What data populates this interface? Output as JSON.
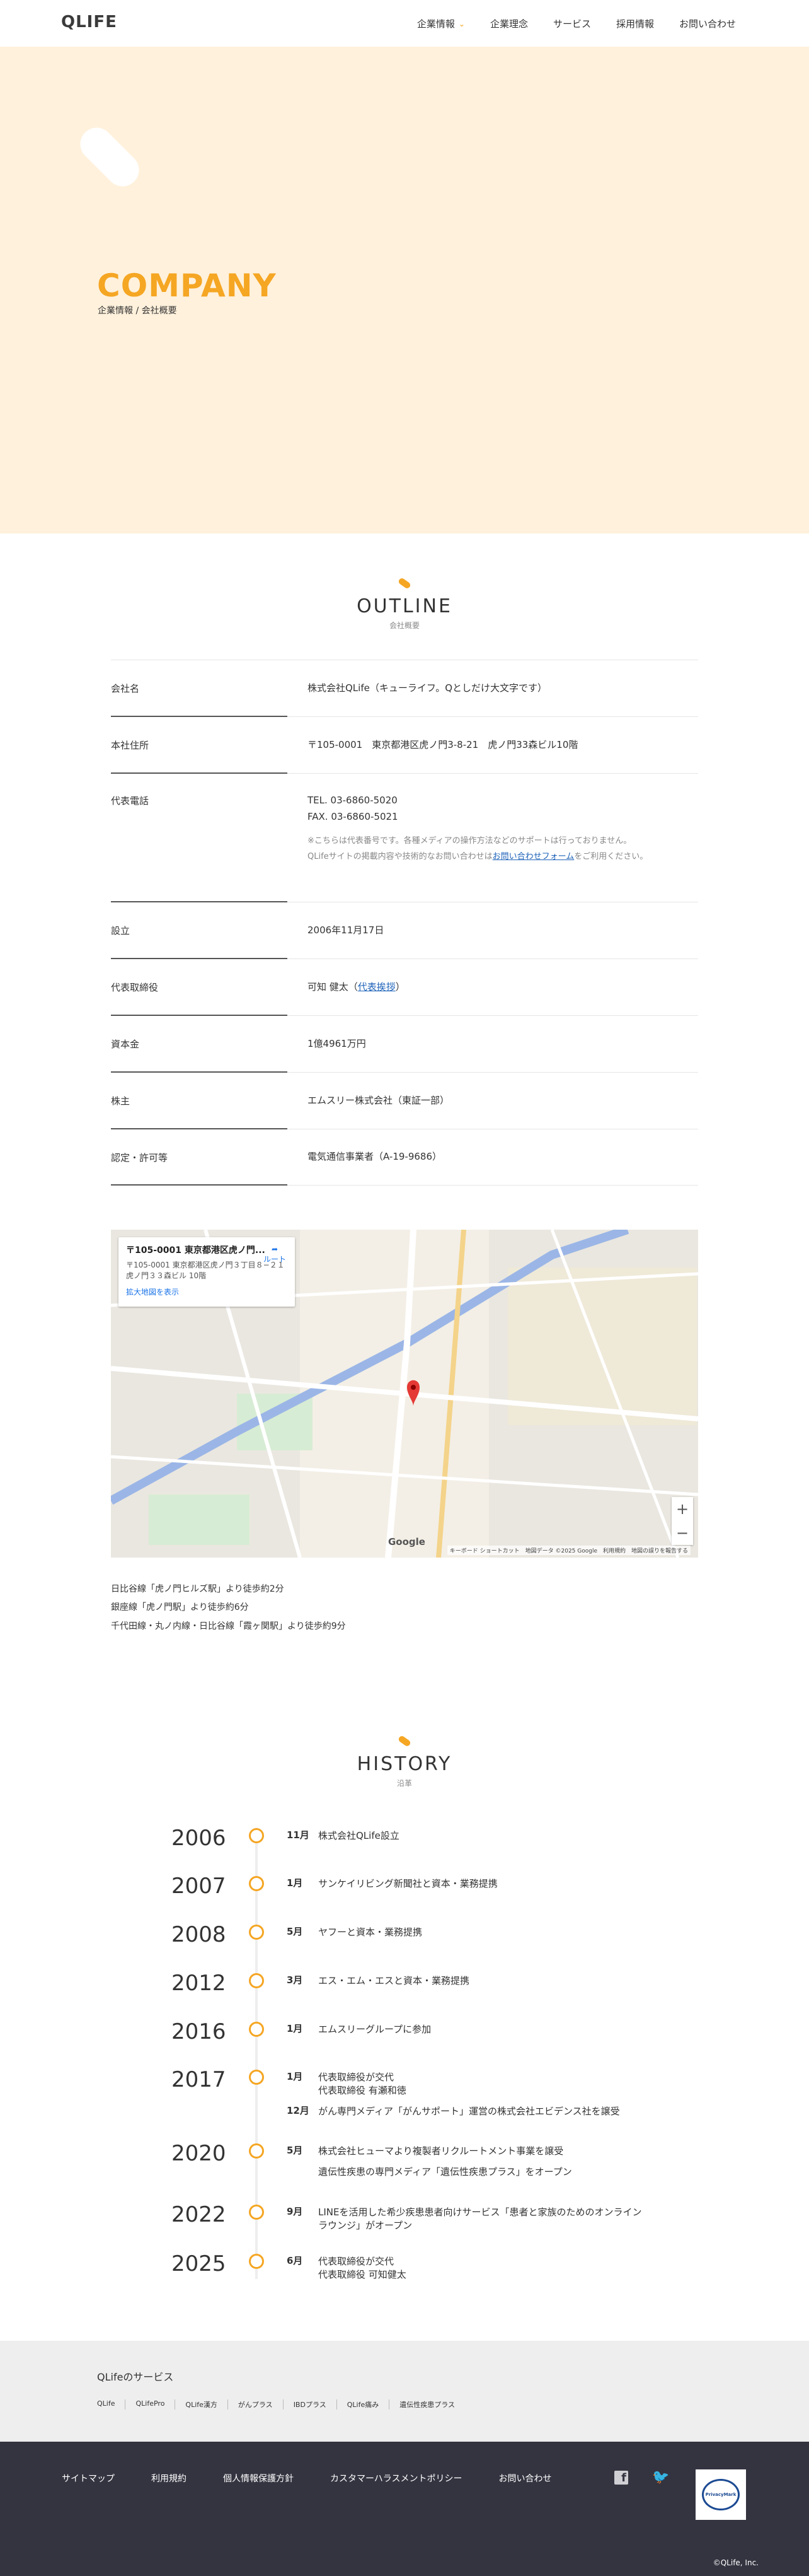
{
  "header": {
    "logo_text": "QLIFE",
    "nav": [
      {
        "label": "企業情報"
      },
      {
        "label": "企業理念"
      },
      {
        "label": "サービス"
      },
      {
        "label": "採用情報"
      },
      {
        "label": "お問い合わせ"
      }
    ]
  },
  "hero": {
    "title": "COMPANY",
    "breadcrumb": "企業情報 / 会社概要"
  },
  "outline": {
    "title": "OUTLINE",
    "subtitle": "会社概要",
    "rows": [
      {
        "label": "会社名",
        "value": "株式会社QLife（キューライフ。Qとしだけ大文字です）"
      },
      {
        "label": "本社住所",
        "value": "〒105-0001　東京都港区虎ノ門3-8-21　虎ノ門33森ビル10階"
      },
      {
        "label": "代表電話",
        "tel": "TEL. 03-6860-5020",
        "fax": "FAX. 03-6860-5021",
        "note1": "※こちらは代表番号です。各種メディアの操作方法などのサポートは行っておりません。",
        "note2_pre": "QLifeサイトの掲載内容や技術的なお問い合わせは",
        "note2_link": "お問い合わせフォーム",
        "note2_post": "をご利用ください。"
      },
      {
        "label": "設立",
        "value": "2006年11月17日"
      },
      {
        "label": "代表取締役",
        "value_pre": "可知 健太（",
        "value_link": "代表挨拶",
        "value_post": "）"
      },
      {
        "label": "資本金",
        "value": "1億4961万円"
      },
      {
        "label": "株主",
        "value": "エムスリー株式会社（東証一部）"
      },
      {
        "label": "認定・許可等",
        "value": "電気通信事業者（A-19-9686）"
      }
    ]
  },
  "map": {
    "card_title": "〒105-0001 東京都港区虎ノ門...",
    "card_address": "〒105-0001 東京都港区虎ノ門３丁目８−２１ 虎ノ門３３森ビル 10階",
    "card_link": "拡大地図を表示",
    "directions": "ルート",
    "attribution": "キーボード ショートカット　地図データ ©2025 Google　利用規約　地図の誤りを報告する",
    "google": "Google",
    "zoom_in": "+",
    "zoom_out": "−"
  },
  "access": [
    "日比谷線「虎ノ門ヒルズ駅」より徒歩約2分",
    "銀座線「虎ノ門駅」より徒歩約6分",
    "千代田線・丸ノ内線・日比谷線「霞ヶ関駅」より徒歩約9分"
  ],
  "history": {
    "title": "HISTORY",
    "subtitle": "沿革",
    "items": [
      {
        "year": "2006",
        "events": [
          {
            "month": "11月",
            "text": "株式会社QLife設立"
          }
        ]
      },
      {
        "year": "2007",
        "events": [
          {
            "month": "1月",
            "text": "サンケイリビング新聞社と資本・業務提携"
          }
        ]
      },
      {
        "year": "2008",
        "events": [
          {
            "month": "5月",
            "text": "ヤフーと資本・業務提携"
          }
        ]
      },
      {
        "year": "2012",
        "events": [
          {
            "month": "3月",
            "text": "エス・エム・エスと資本・業務提携"
          }
        ]
      },
      {
        "year": "2016",
        "events": [
          {
            "month": "1月",
            "text": "エムスリーグループに参加"
          }
        ]
      },
      {
        "year": "2017",
        "events": [
          {
            "month": "1月",
            "text": "代表取締役が交代\n代表取締役 有瀬和徳"
          },
          {
            "month": "12月",
            "text": "がん専門メディア「がんサポート」運営の株式会社エビデンス社を譲受"
          }
        ]
      },
      {
        "year": "2020",
        "events": [
          {
            "month": "5月",
            "text": "株式会社ヒューマより複製者リクルートメント事業を譲受"
          },
          {
            "month": "",
            "text": "遺伝性疾患の専門メディア「遺伝性疾患プラス」をオープン"
          }
        ]
      },
      {
        "year": "2022",
        "events": [
          {
            "month": "9月",
            "text": "LINEを活用した希少疾患患者向けサービス「患者と家族のためのオンラインラウンジ」がオープン"
          }
        ]
      },
      {
        "year": "2025",
        "events": [
          {
            "month": "6月",
            "text": "代表取締役が交代\n代表取締役 可知健太"
          }
        ]
      }
    ]
  },
  "services": {
    "title": "QLifeのサービス",
    "links": [
      "QLife",
      "QLifePro",
      "QLife漢方",
      "がんプラス",
      "IBDプラス",
      "QLife痛み",
      "遺伝性疾患プラス"
    ]
  },
  "footer": {
    "links": [
      "サイトマップ",
      "利用規約",
      "個人情報保護方針",
      "カスタマーハラスメントポリシー",
      "お問い合わせ"
    ],
    "privacy_mark": "PrivacyMark",
    "copyright": "©QLife, Inc."
  },
  "colors": {
    "accent": "#f5a623",
    "hero_bg": "#fff1dc",
    "footer_bg": "#343441",
    "link": "#1d62b8"
  }
}
